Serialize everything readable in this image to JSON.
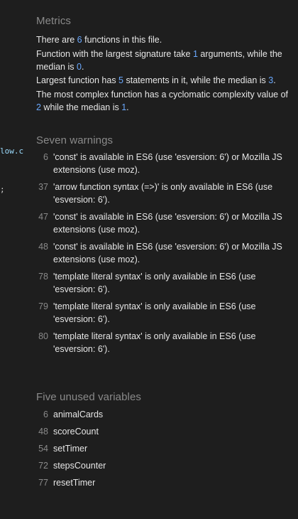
{
  "code_edge": {
    "line1": "low.c",
    "line2": ";"
  },
  "metrics": {
    "title": "Metrics",
    "functions": {
      "pre": "There are ",
      "value": "6",
      "post": " functions in this file."
    },
    "signature": {
      "pre": "Function with the largest signature take ",
      "value": "1",
      "mid": " arguments, while the median is ",
      "median": "0",
      "post": "."
    },
    "statements": {
      "pre": "Largest function has ",
      "value": "5",
      "mid": " statements in it, while the median is ",
      "median": "3",
      "post": "."
    },
    "complexity": {
      "pre": "The most complex function has a cyclomatic complexity value of ",
      "value": "2",
      "mid": " while the median is ",
      "median": "1",
      "post": "."
    }
  },
  "warnings": {
    "title": "Seven warnings",
    "items": [
      {
        "line": "6",
        "text": "'const' is available in ES6 (use 'esversion: 6') or Mozilla JS extensions (use moz)."
      },
      {
        "line": "37",
        "text": "'arrow function syntax (=>)' is only available in ES6 (use 'esversion: 6')."
      },
      {
        "line": "47",
        "text": "'const' is available in ES6 (use 'esversion: 6') or Mozilla JS extensions (use moz)."
      },
      {
        "line": "48",
        "text": "'const' is available in ES6 (use 'esversion: 6') or Mozilla JS extensions (use moz)."
      },
      {
        "line": "78",
        "text": "'template literal syntax' is only available in ES6 (use 'esversion: 6')."
      },
      {
        "line": "79",
        "text": "'template literal syntax' is only available in ES6 (use 'esversion: 6')."
      },
      {
        "line": "80",
        "text": "'template literal syntax' is only available in ES6 (use 'esversion: 6')."
      }
    ]
  },
  "unused": {
    "title": "Five unused variables",
    "items": [
      {
        "line": "6",
        "name": "animalCards"
      },
      {
        "line": "48",
        "name": "scoreCount"
      },
      {
        "line": "54",
        "name": "setTimer"
      },
      {
        "line": "72",
        "name": "stepsCounter"
      },
      {
        "line": "77",
        "name": "resetTimer"
      }
    ]
  }
}
